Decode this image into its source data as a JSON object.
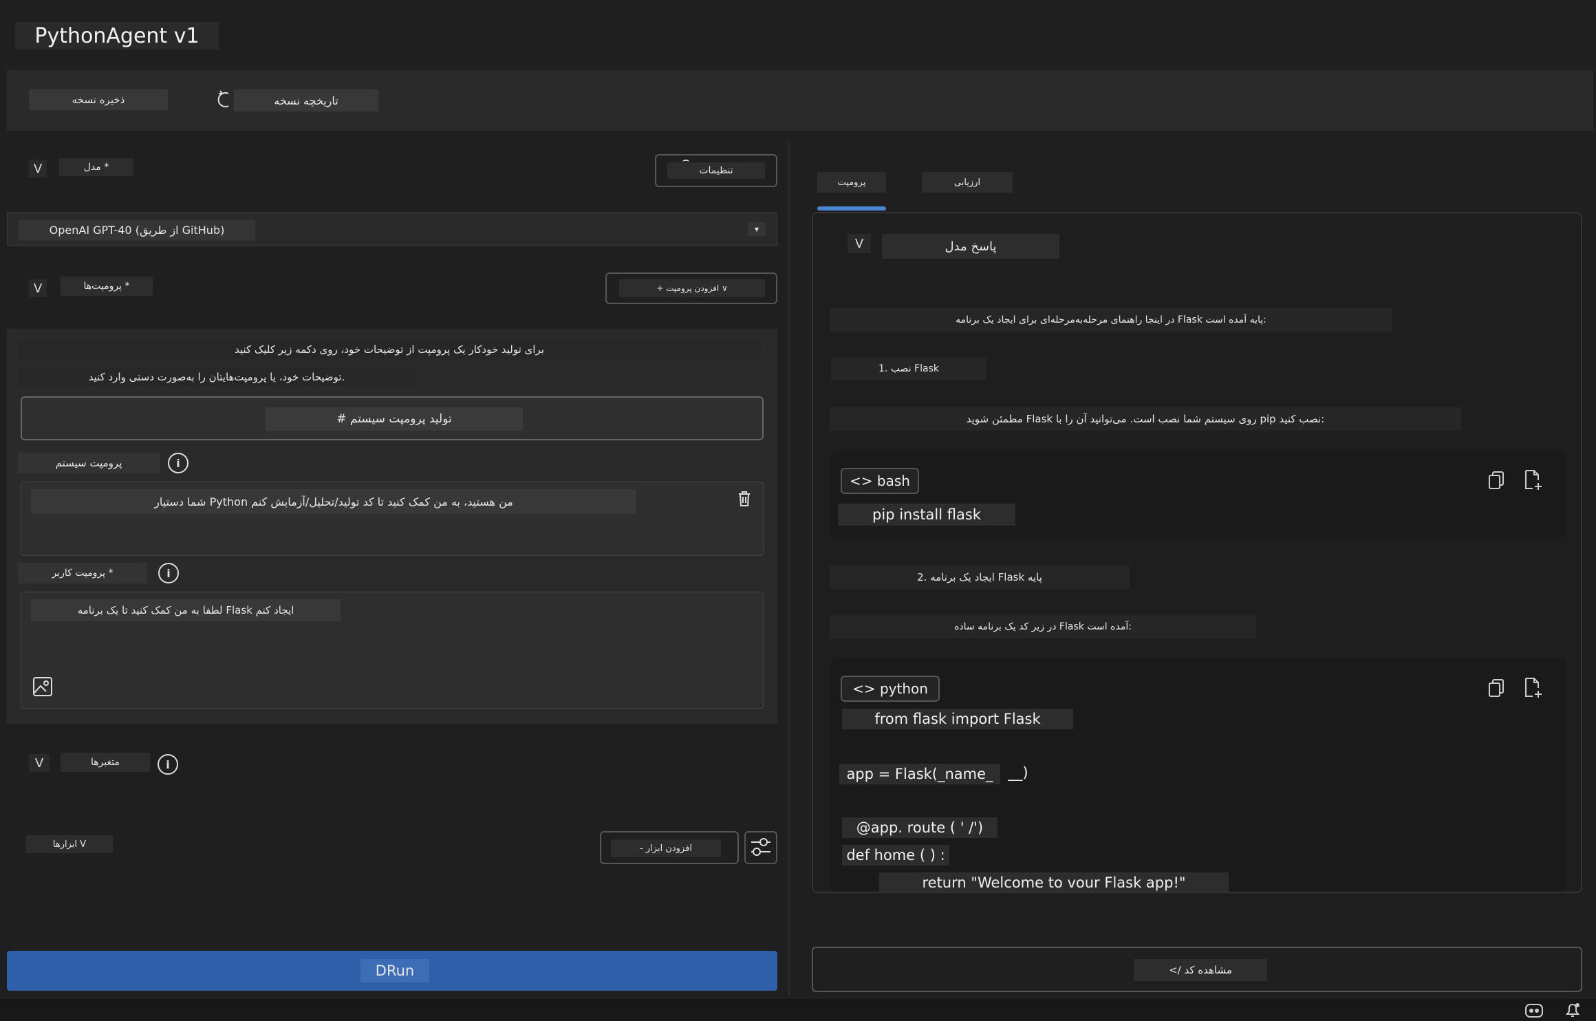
{
  "app": {
    "title": "PythonAgent v1"
  },
  "toolbar": {
    "save_label": "ذخیره نسخه",
    "history_label": "تاریخچه نسخه"
  },
  "settings": {
    "label": "تنظیمات"
  },
  "model": {
    "section_label": "مدل *",
    "chevron": "V",
    "selected": "OpenAI GPT-40 (از طریق GitHub)",
    "dropdown_glyph": "▾"
  },
  "prompts": {
    "section_label": "پرومپت‌ها *",
    "chevron": "V",
    "add_label": "+ افزودن پرومپت ∨",
    "hint_line1": "برای تولید خودکار یک پرومپت از توضیحات خود، روی دکمه زیر کلیک کنید",
    "hint_line2": "توضیحات خود، یا پرومپت‌هایتان را به‌صورت دستی وارد کنید.",
    "generate_label": "# تولید پرومپت سیستم",
    "system_label": "پرومپت سیستم",
    "system_value": "شما دستیار Python من هستید، به من کمک کنید تا کد تولید/تحلیل/آزمایش کنم",
    "user_label": "پرومپت کاربر *",
    "user_value": "لطفا به من کمک کنید تا یک برنامه Flask ایجاد کنم"
  },
  "variables": {
    "label": "متغیرها",
    "chevron": "V"
  },
  "tools": {
    "label": "ابزارها V",
    "add_label": "- افزودن ابزار"
  },
  "run": {
    "label": "DRun"
  },
  "tabs": [
    {
      "label": "پرومپت",
      "active": true
    },
    {
      "label": "ارزیابی",
      "active": false
    }
  ],
  "response": {
    "header": "پاسخ مدل",
    "chevron": "V",
    "intro": "در اینجا راهنمای مرحله‌به‌مرحله‌ای برای ایجاد یک برنامه Flask پایه آمده است:",
    "step1": "1. نصب Flask",
    "step1_text": "مطمئن شوید Flask روی سیستم شما نصب است. می‌توانید آن را با pip نصب کنید:",
    "bash_lang": "<> bash",
    "bash_code": "pip install flask",
    "step2": "2. ایجاد یک برنامه Flask پایه",
    "step2_text": "در زیر کد یک برنامه ساده Flask آمده است:",
    "python_lang": "<> python",
    "code_lines": [
      "from flask import Flask",
      "app = Flask(_name_",
      "__)",
      "@app. route ( ' /')",
      "def home ( ) :",
      "return \"Welcome to vour Flask app!\""
    ]
  },
  "view_code": {
    "label": "</ مشاهده کد"
  },
  "colors": {
    "accent": "#2f5fa8",
    "tab_indicator": "#4a86d4",
    "background": "#1f1f1f"
  }
}
